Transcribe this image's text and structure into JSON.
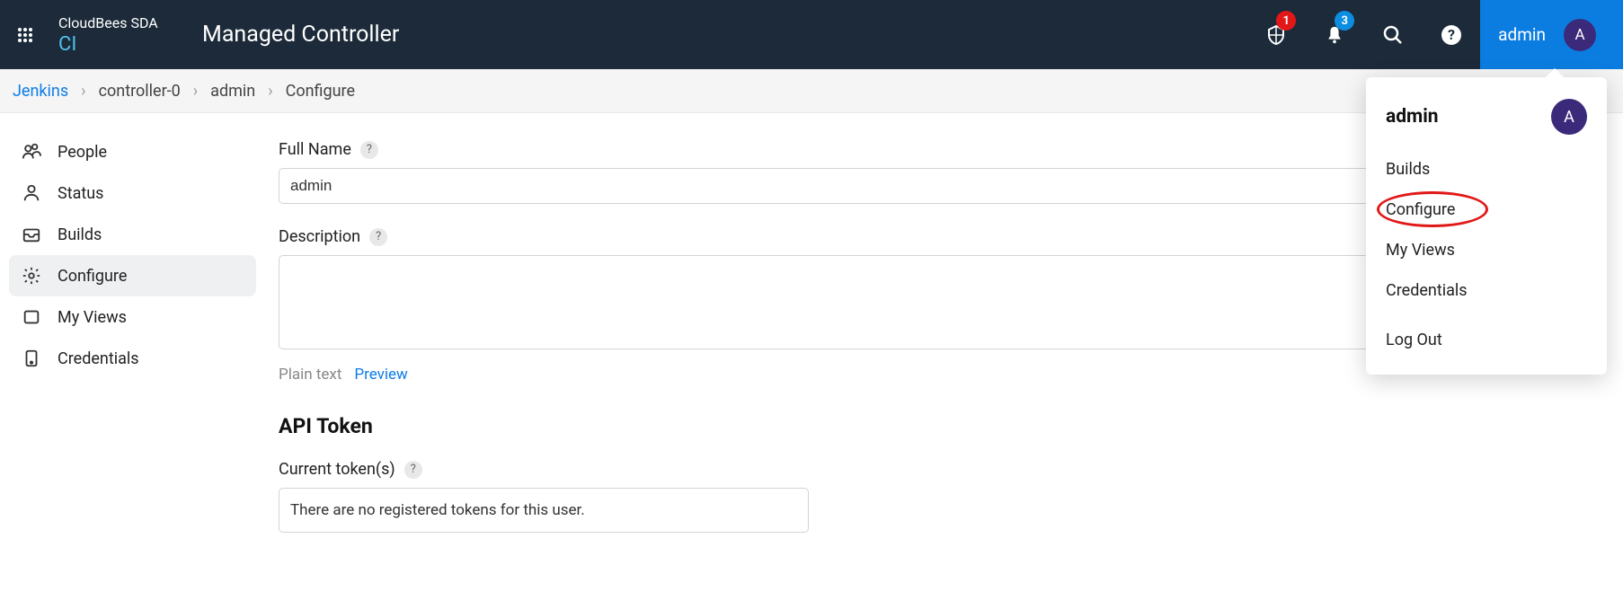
{
  "header": {
    "brand_top": "CloudBees SDA",
    "brand_sub": "CI",
    "title": "Managed Controller",
    "shield_badge": "1",
    "bell_badge": "3",
    "user_label": "admin",
    "avatar_initial": "A"
  },
  "breadcrumbs": [
    {
      "label": "Jenkins",
      "link": true
    },
    {
      "label": "controller-0",
      "link": false
    },
    {
      "label": "admin",
      "link": false
    },
    {
      "label": "Configure",
      "link": false
    }
  ],
  "sidebar": {
    "items": [
      {
        "icon": "people",
        "label": "People"
      },
      {
        "icon": "person",
        "label": "Status"
      },
      {
        "icon": "tray",
        "label": "Builds"
      },
      {
        "icon": "gear",
        "label": "Configure",
        "active": true
      },
      {
        "icon": "square",
        "label": "My Views"
      },
      {
        "icon": "phone",
        "label": "Credentials"
      }
    ]
  },
  "form": {
    "full_name_label": "Full Name",
    "full_name_value": "admin",
    "description_label": "Description",
    "description_value": "",
    "plain_text_label": "Plain text",
    "preview_label": "Preview",
    "api_token_heading": "API Token",
    "current_tokens_label": "Current token(s)",
    "no_tokens_text": "There are no registered tokens for this user."
  },
  "dropdown": {
    "title": "admin",
    "avatar_initial": "A",
    "items": [
      {
        "label": "Builds"
      },
      {
        "label": "Configure",
        "highlighted": true
      },
      {
        "label": "My Views"
      },
      {
        "label": "Credentials"
      },
      {
        "label": "Log Out",
        "gap_before": true
      }
    ]
  }
}
